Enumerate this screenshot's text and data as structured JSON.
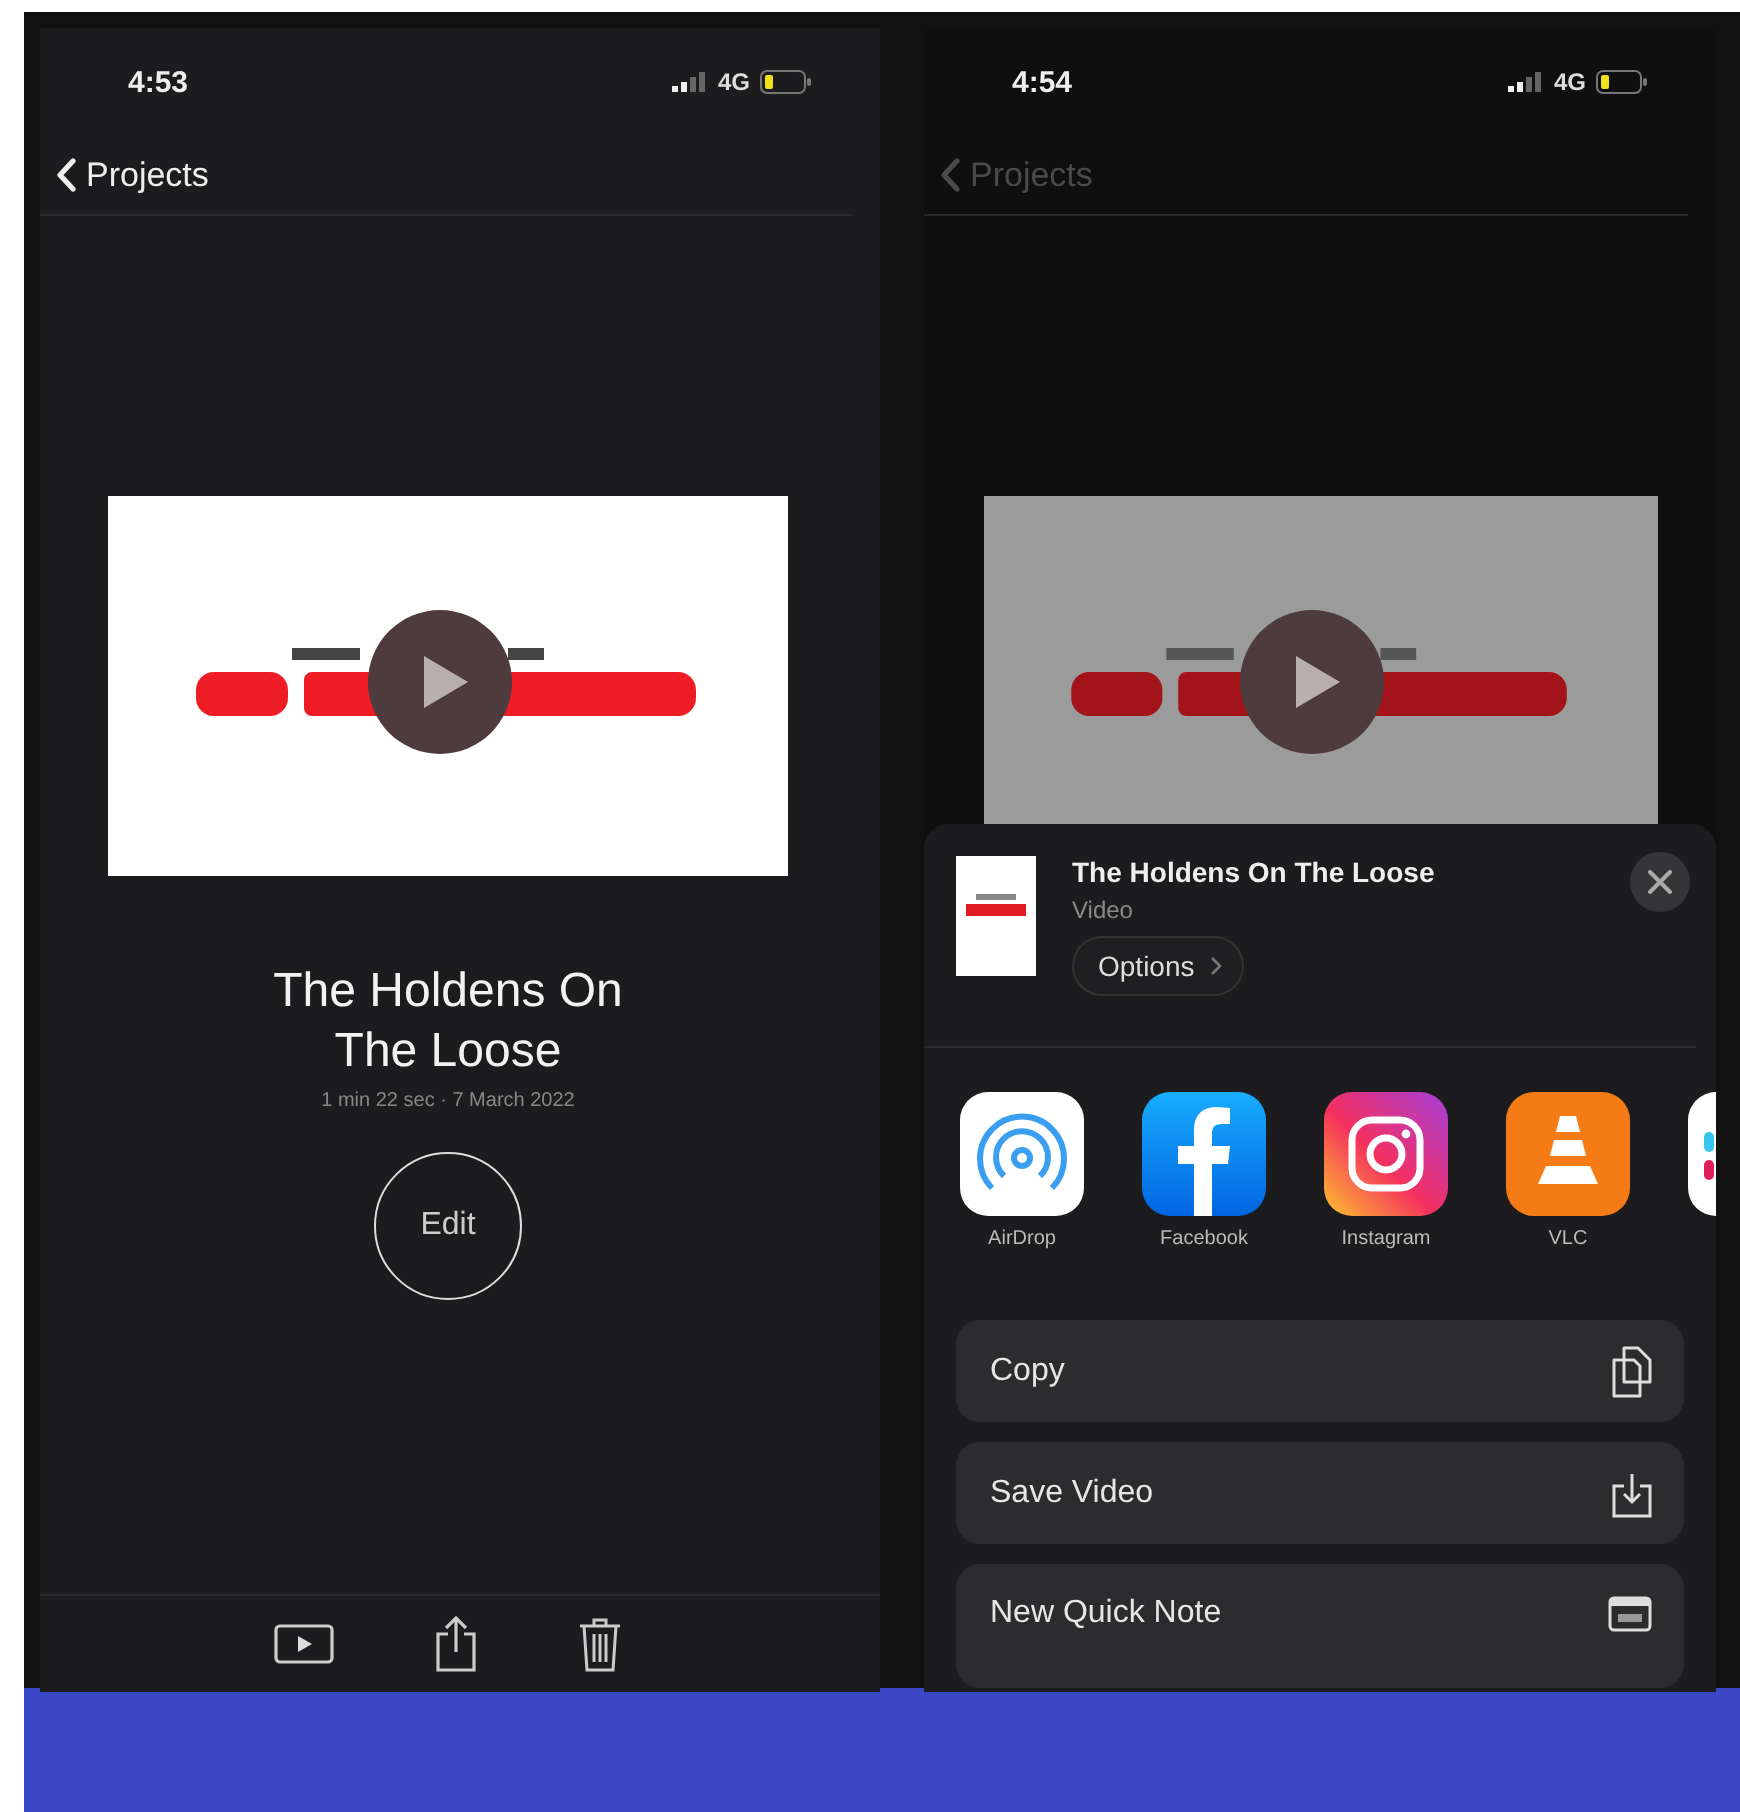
{
  "screens": [
    {
      "kind": "detail",
      "status": {
        "time": "4:53",
        "network": "4G"
      },
      "back": {
        "label": "Projects",
        "disabled": false
      },
      "project": {
        "title": "The Holdens On The Loose",
        "meta": "1 min 22 sec · 7 March 2022"
      },
      "edit_label": "Edit",
      "toolbar": [
        {
          "kind": "play"
        },
        {
          "kind": "share"
        },
        {
          "kind": "trash"
        }
      ]
    },
    {
      "kind": "share",
      "status": {
        "time": "4:54",
        "network": "4G"
      },
      "back": {
        "label": "Projects",
        "disabled": true
      },
      "sheet": {
        "title": "The Holdens On The Loose",
        "subtitle": "Video",
        "options": "Options",
        "apps": [
          {
            "name": "AirDrop",
            "kind": "airdrop"
          },
          {
            "name": "Facebook",
            "kind": "facebook"
          },
          {
            "name": "Instagram",
            "kind": "instagram"
          },
          {
            "name": "VLC",
            "kind": "vlc"
          }
        ],
        "actions": [
          {
            "label": "Copy",
            "kind": "copy"
          },
          {
            "label": "Save Video",
            "kind": "save"
          },
          {
            "label": "New Quick Note",
            "kind": "note"
          }
        ]
      }
    }
  ]
}
